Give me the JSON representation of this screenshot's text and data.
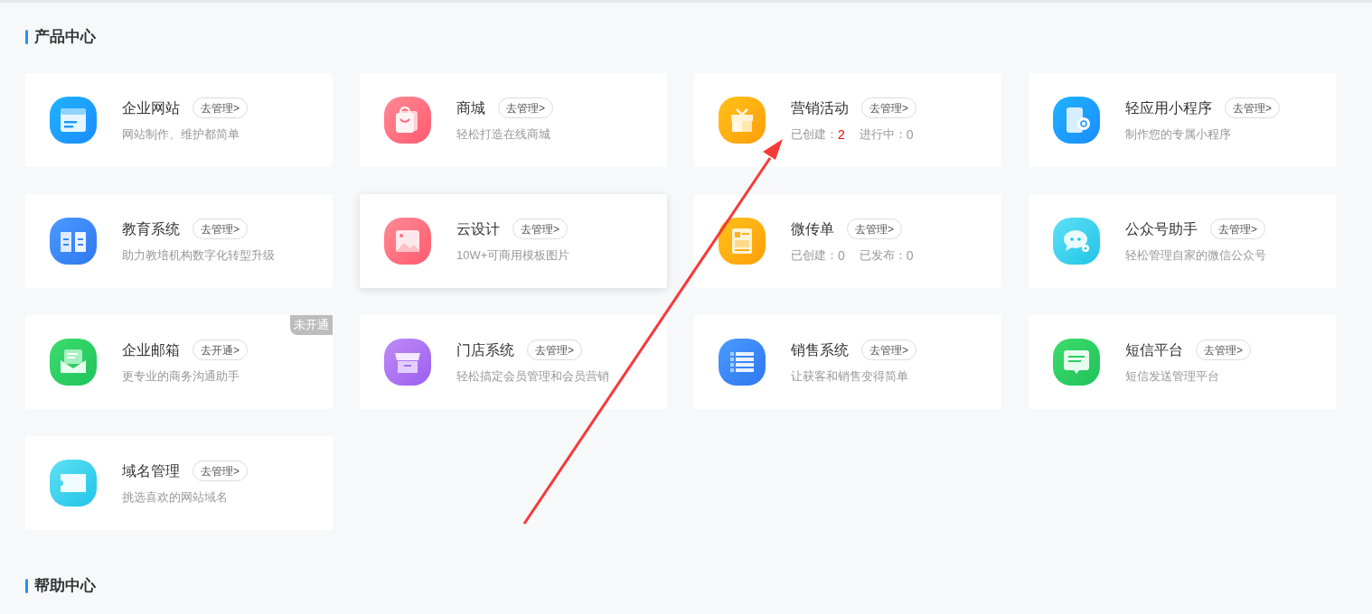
{
  "sections": [
    {
      "title": "产品中心",
      "cards": [
        {
          "title": "企业网站",
          "action": "去管理>",
          "hovered": false,
          "description": "网站制作、维护都简单"
        },
        {
          "title": "商城",
          "action": "去管理>",
          "hovered": false,
          "description": "轻松打造在线商城"
        },
        {
          "title": "营销活动",
          "action": "去管理>",
          "hovered": false,
          "stats": [
            {
              "label": "已创建：",
              "value": "2",
              "color": "#ff0000"
            },
            {
              "label": "进行中：",
              "value": "0",
              "color": "#999999"
            }
          ]
        },
        {
          "title": "轻应用小程序",
          "action": "去管理>",
          "hovered": false,
          "description": "制作您的专属小程序"
        },
        {
          "title": "教育系统",
          "action": "去管理>",
          "hovered": false,
          "description": "助力教培机构数字化转型升级"
        },
        {
          "title": "云设计",
          "action": "去管理>",
          "hovered": true,
          "description": "10W+可商用模板图片"
        },
        {
          "title": "微传单",
          "action": "去管理>",
          "hovered": false,
          "stats": [
            {
              "label": "已创建：",
              "value": "0",
              "color": "#999999"
            },
            {
              "label": "已发布：",
              "value": "0",
              "color": "#999999"
            }
          ]
        },
        {
          "title": "公众号助手",
          "action": "去管理>",
          "hovered": false,
          "description": "轻松管理自家的微信公众号"
        },
        {
          "title": "企业邮箱",
          "action": "去开通>",
          "hovered": false,
          "badge": "未开通",
          "description": "更专业的商务沟通助手"
        },
        {
          "title": "门店系统",
          "action": "去管理>",
          "hovered": false,
          "description": "轻松搞定会员管理和会员营销"
        },
        {
          "title": "销售系统",
          "action": "去管理>",
          "hovered": false,
          "description": "让获客和销售变得简单"
        },
        {
          "title": "短信平台",
          "action": "去管理>",
          "hovered": false,
          "description": "短信发送管理平台"
        },
        {
          "title": "域名管理",
          "action": "去管理>",
          "hovered": false,
          "description": "挑选喜欢的网站域名"
        }
      ]
    },
    {
      "title": "帮助中心"
    }
  ]
}
